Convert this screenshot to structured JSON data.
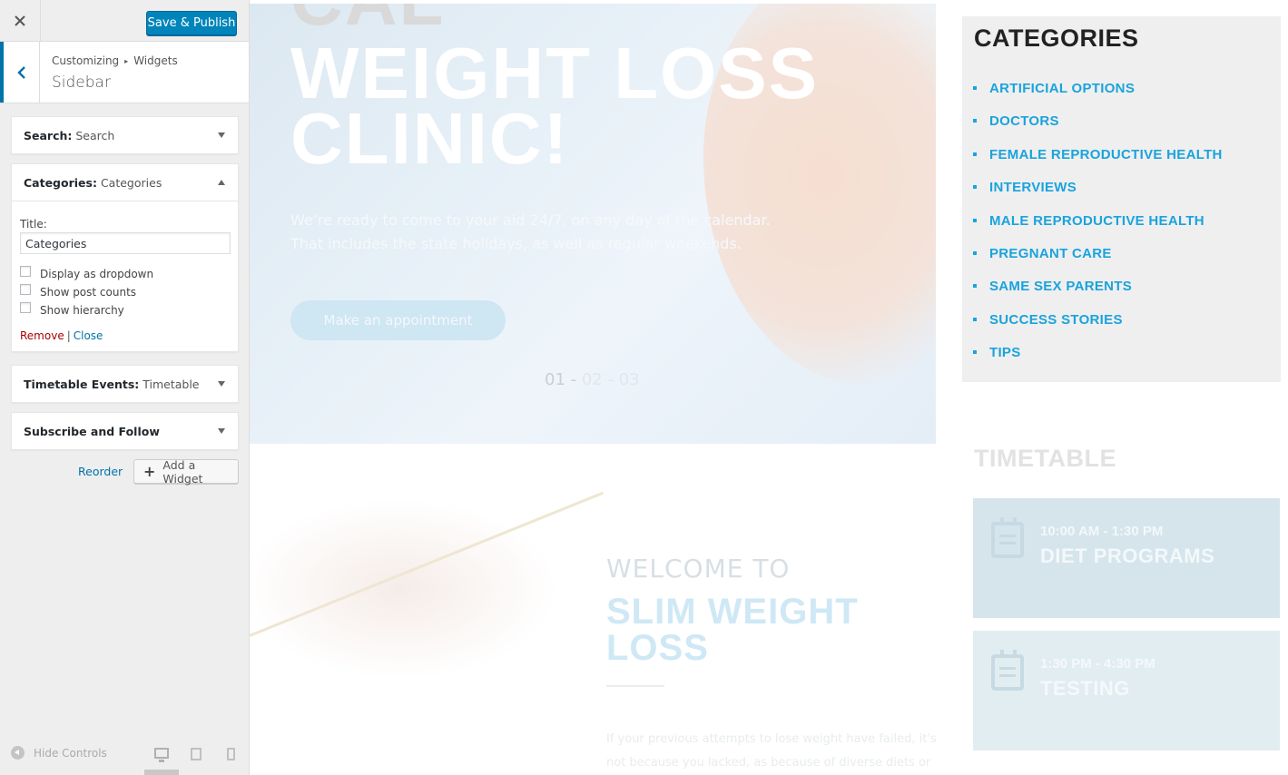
{
  "customizer": {
    "close_icon": "close-icon",
    "save_label": "Save & Publish",
    "breadcrumb": {
      "root": "Customizing",
      "section": "Widgets"
    },
    "panel_title": "Sidebar",
    "widgets": {
      "search": {
        "name": "Search:",
        "title": "Search"
      },
      "categories": {
        "name": "Categories:",
        "title": "Categories",
        "title_label": "Title:",
        "title_value": "Categories",
        "options": [
          {
            "label": "Display as dropdown",
            "checked": false
          },
          {
            "label": "Show post counts",
            "checked": false
          },
          {
            "label": "Show hierarchy",
            "checked": false
          }
        ],
        "remove_label": "Remove",
        "separator": "|",
        "close_label": "Close"
      },
      "timetable": {
        "name": "Timetable Events:",
        "title": "Timetable"
      },
      "subscribe": {
        "name": "Subscribe and Follow"
      }
    },
    "reorder_label": "Reorder",
    "add_widget_label": "Add a Widget",
    "hide_controls_label": "Hide Controls",
    "active_device": "desktop",
    "accent_color": "#0073aa",
    "save_color": "#0085ba"
  },
  "preview": {
    "hero": {
      "line0": "CAL",
      "line1": "WEIGHT LOSS",
      "line2": "CLINIC!",
      "text1": "We’re ready to come to your aid 24/7, on any day of the calendar.",
      "text2": "That includes the state holidays, as well as regular weekends.",
      "button": "Make an appointment",
      "slide_current": "01",
      "slide_sep1": " - ",
      "slide_2": "02",
      "slide_sep2": " - ",
      "slide_3": "03"
    },
    "welcome": {
      "pre": "WELCOME TO",
      "line1": "SLIM WEIGHT",
      "line2": "LOSS",
      "para1": "If your previous attempts to lose weight have failed, it's",
      "para2": "not because you lacked, as because of diverse diets or"
    },
    "categories_widget": {
      "title": "CATEGORIES",
      "items": [
        "ARTIFICIAL OPTIONS",
        "DOCTORS",
        "FEMALE REPRODUCTIVE HEALTH",
        "INTERVIEWS",
        "MALE REPRODUCTIVE HEALTH",
        "PREGNANT CARE",
        "SAME SEX PARENTS",
        "SUCCESS STORIES",
        "TIPS"
      ],
      "link_color": "#1aa3dd"
    },
    "timetable_widget": {
      "title": "TIMETABLE",
      "events": [
        {
          "time": "10:00 AM - 1:30 PM",
          "name": "DIET PROGRAMS"
        },
        {
          "time": "1:30 PM - 4:30 PM",
          "name": "TESTING"
        }
      ]
    }
  }
}
